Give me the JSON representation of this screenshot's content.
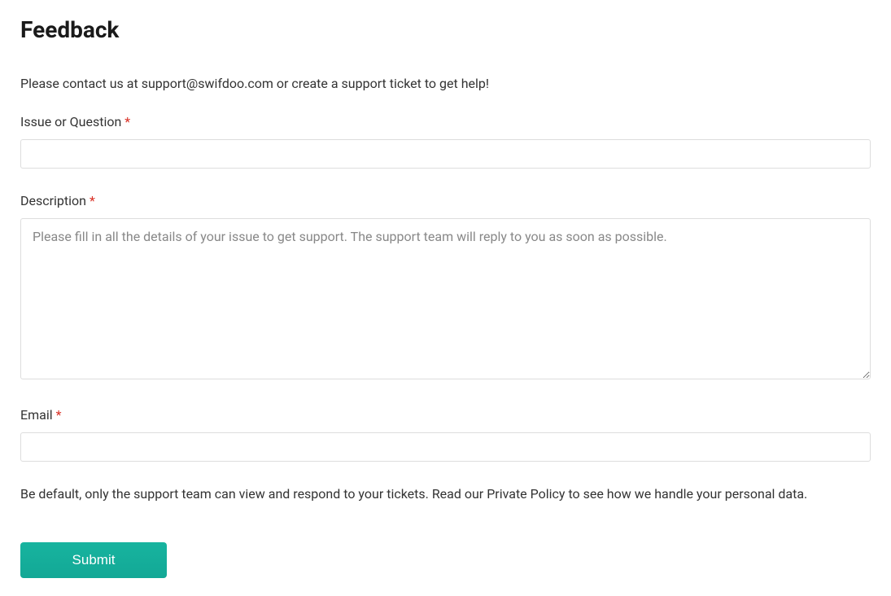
{
  "page": {
    "title": "Feedback",
    "intro": "Please contact us at support@swifdoo.com or create a support ticket to get help!",
    "policy": "Be default, only the support team can view and respond to your tickets. Read our Private Policy to see how we handle your personal data."
  },
  "form": {
    "issue": {
      "label": "Issue or Question ",
      "required": "*",
      "value": ""
    },
    "description": {
      "label": "Description ",
      "required": "*",
      "placeholder": "Please fill in all the details of your issue to get support. The support team will reply to you as soon as possible.",
      "value": ""
    },
    "email": {
      "label": "Email ",
      "required": "*",
      "value": ""
    },
    "submit_label": "Submit"
  }
}
